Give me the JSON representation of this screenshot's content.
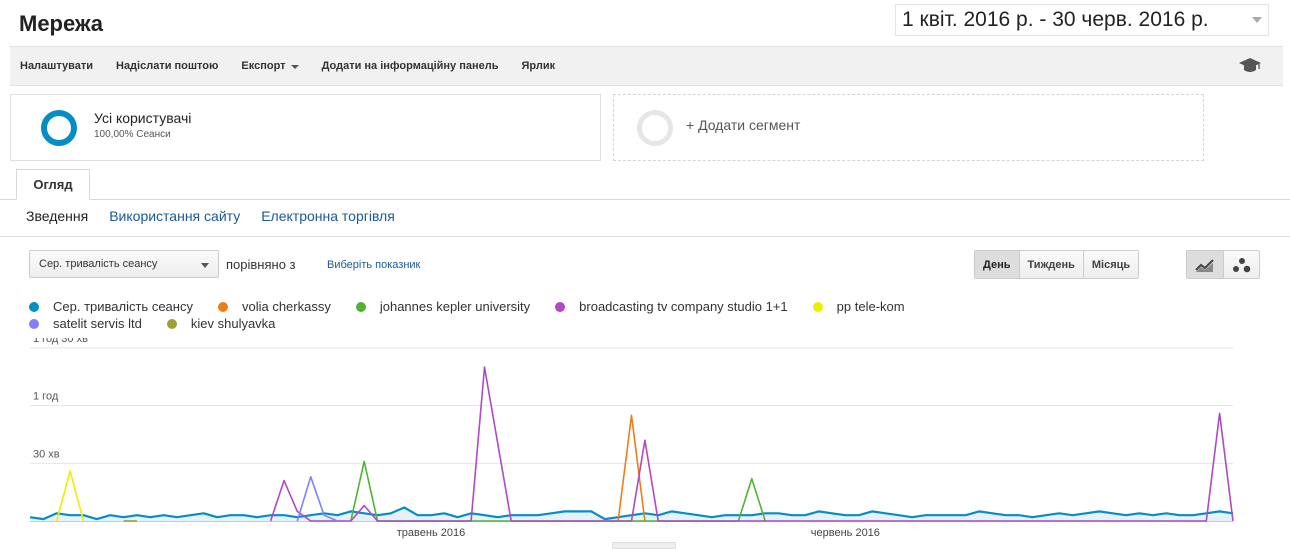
{
  "header": {
    "title": "Мережа",
    "date_range": "1 квіт. 2016 р. - 30 черв. 2016 р."
  },
  "toolbar": {
    "items": [
      {
        "label": "Налаштувати",
        "dropdown": false
      },
      {
        "label": "Надіслати поштою",
        "dropdown": false
      },
      {
        "label": "Експорт",
        "dropdown": true
      },
      {
        "label": "Додати на інформаційну панель",
        "dropdown": false
      },
      {
        "label": "Ярлик",
        "dropdown": false
      }
    ],
    "icon": "graduation-cap-icon"
  },
  "segments": {
    "active": {
      "name": "Усі користувачі",
      "sub": "100,00% Сеанси",
      "color": "#058dc7"
    },
    "add_label": "+ Додати сегмент"
  },
  "tabs": [
    {
      "label": "Огляд"
    }
  ],
  "subnav": {
    "active": "Зведення",
    "links": [
      "Використання сайту",
      "Електронна торгівля"
    ]
  },
  "controls": {
    "metric": "Сер. тривалість сеансу",
    "compare_label": "порівняно з",
    "choose_metric": "Виберіть показник",
    "periods": [
      "День",
      "Тиждень",
      "Місяць"
    ],
    "active_period": "День",
    "view_icons": [
      "line-chart-icon",
      "motion-chart-icon"
    ]
  },
  "chart_data": {
    "type": "line",
    "ylim": [
      0,
      90
    ],
    "y_unit": "minutes",
    "y_ticks": [
      {
        "value": 30,
        "label": "30 хв"
      },
      {
        "value": 60,
        "label": "1 год"
      },
      {
        "value": 90,
        "label": "1 год 30 хв"
      }
    ],
    "x_ticks": [
      {
        "day": 30,
        "label": "травень 2016"
      },
      {
        "day": 61,
        "label": "червень 2016"
      }
    ],
    "x_range": [
      0,
      90
    ],
    "grid": true,
    "legend_position": "top",
    "series": [
      {
        "name": "Сер. тривалість сеансу",
        "color": "#058dc7",
        "values": [
          2,
          1,
          4,
          3,
          3,
          1,
          3,
          2,
          3,
          2,
          3,
          2,
          3,
          4,
          2,
          3,
          3,
          2,
          3,
          3,
          2,
          3,
          4,
          3,
          5,
          4,
          3,
          4,
          7,
          3,
          3,
          4,
          2,
          4,
          3,
          2,
          3,
          3,
          3,
          4,
          5,
          5,
          5,
          1,
          2,
          3,
          4,
          3,
          5,
          4,
          3,
          2,
          3,
          3,
          3,
          4,
          4,
          3,
          3,
          5,
          4,
          3,
          3,
          5,
          4,
          3,
          2,
          3,
          3,
          3,
          3,
          5,
          4,
          3,
          3,
          2,
          3,
          4,
          3,
          4,
          5,
          4,
          3,
          4,
          3,
          4,
          3,
          3,
          4,
          5,
          4
        ]
      },
      {
        "name": "volia cherkassy",
        "color": "#ed7e17",
        "points": [
          [
            44,
            0
          ],
          [
            45,
            55
          ],
          [
            46,
            0
          ]
        ]
      },
      {
        "name": "johannes kepler university",
        "color": "#50b432",
        "points": [
          [
            24,
            0
          ],
          [
            25,
            31
          ],
          [
            26,
            0
          ],
          [
            53,
            0
          ],
          [
            54,
            22
          ],
          [
            55,
            0
          ]
        ]
      },
      {
        "name": "broadcasting tv company studio 1+1",
        "color": "#af49c5",
        "points": [
          [
            18,
            0
          ],
          [
            19,
            21
          ],
          [
            20,
            5
          ],
          [
            21,
            0
          ],
          [
            24,
            0
          ],
          [
            25,
            8
          ],
          [
            26,
            0
          ],
          [
            33,
            0
          ],
          [
            34,
            80
          ],
          [
            36,
            0
          ],
          [
            45,
            0
          ],
          [
            46,
            42
          ],
          [
            47,
            0
          ],
          [
            88,
            0
          ],
          [
            89,
            56
          ],
          [
            90,
            0
          ]
        ]
      },
      {
        "name": "pp tele-kom",
        "color": "#edef00",
        "points": [
          [
            2,
            0
          ],
          [
            3,
            26
          ],
          [
            4,
            0
          ]
        ]
      },
      {
        "name": "satelit servis ltd",
        "color": "#8080ff",
        "points": [
          [
            20,
            0
          ],
          [
            21,
            23
          ],
          [
            22,
            3
          ],
          [
            23,
            0
          ]
        ]
      },
      {
        "name": "kiev shulyavka",
        "color": "#a0a030",
        "points": [
          [
            7,
            0
          ],
          [
            8,
            0
          ]
        ]
      }
    ]
  }
}
